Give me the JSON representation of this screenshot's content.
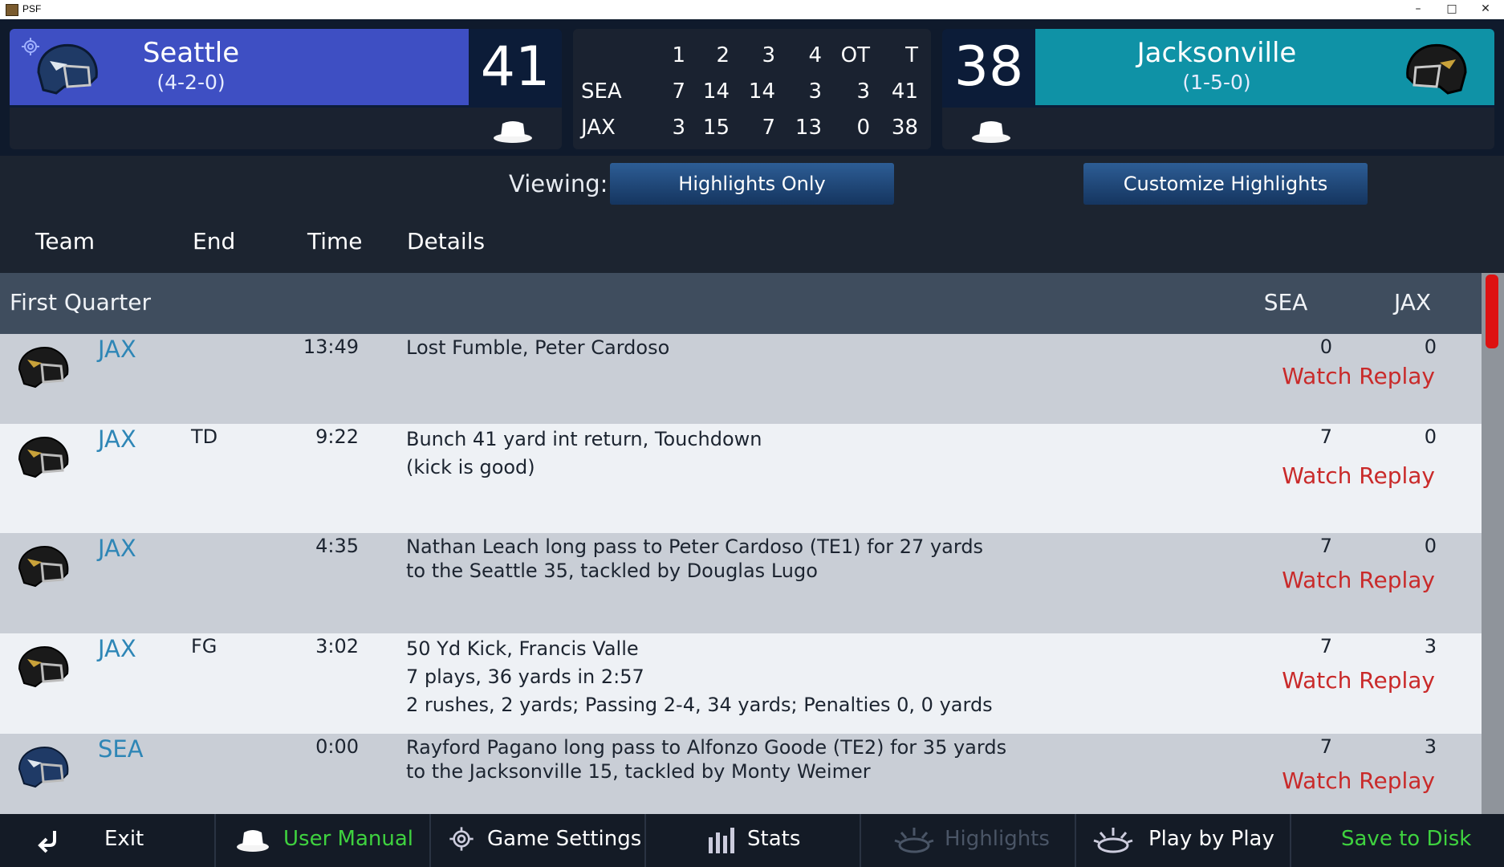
{
  "window": {
    "title": "PSF",
    "minimize": "–",
    "maximize": "□",
    "close": "✕"
  },
  "home": {
    "name": "Seattle",
    "record": "(4-2-0)",
    "score": "41",
    "color": "#3e4fc3"
  },
  "away": {
    "name": "Jacksonville",
    "record": "(1-5-0)",
    "score": "38",
    "color": "#0f92a6"
  },
  "linescore": {
    "headers": [
      "1",
      "2",
      "3",
      "4",
      "OT",
      "T"
    ],
    "rows": [
      {
        "team": "SEA",
        "values": [
          "7",
          "14",
          "14",
          "3",
          "3",
          "41"
        ]
      },
      {
        "team": "JAX",
        "values": [
          "3",
          "15",
          "7",
          "13",
          "0",
          "38"
        ]
      }
    ]
  },
  "viewing": {
    "label": "Viewing:",
    "mode": "Highlights Only",
    "customize": "Customize Highlights"
  },
  "columns": {
    "team": "Team",
    "end": "End",
    "time": "Time",
    "details": "Details"
  },
  "quarter": {
    "title": "First Quarter",
    "col1": "SEA",
    "col2": "JAX"
  },
  "plays": [
    {
      "team": "JAX",
      "end": "",
      "time": "13:49",
      "details": [
        "Lost Fumble, Peter Cardoso"
      ],
      "sea": "0",
      "jax": "0",
      "replay": "Watch Replay",
      "helmet": "jaguar-helmet"
    },
    {
      "team": "JAX",
      "end": "TD",
      "time": "9:22",
      "details": [
        "Bunch 41 yard int return, Touchdown",
        "(kick is good)"
      ],
      "sea": "7",
      "jax": "0",
      "replay": "Watch Replay",
      "helmet": "jaguar-helmet"
    },
    {
      "team": "JAX",
      "end": "",
      "time": "4:35",
      "details": [
        "Nathan Leach long pass to Peter Cardoso (TE1) for 27 yards",
        "to the Seattle 35, tackled by Douglas Lugo"
      ],
      "sea": "7",
      "jax": "0",
      "replay": "Watch Replay",
      "helmet": "jaguar-helmet"
    },
    {
      "team": "JAX",
      "end": "FG",
      "time": "3:02",
      "details": [
        "50 Yd Kick, Francis Valle",
        "7 plays, 36 yards in 2:57",
        "2 rushes, 2 yards;  Passing 2-4, 34 yards;  Penalties 0, 0 yards"
      ],
      "sea": "7",
      "jax": "3",
      "replay": "Watch Replay",
      "helmet": "jaguar-helmet"
    },
    {
      "team": "SEA",
      "end": "",
      "time": "0:00",
      "details": [
        "Rayford Pagano long pass to Alfonzo Goode (TE2) for 35 yards",
        "to the Jacksonville 15, tackled by Monty Weimer"
      ],
      "sea": "7",
      "jax": "3",
      "replay": "Watch Replay",
      "helmet": "seahawk-helmet"
    }
  ],
  "nav": {
    "exit": "Exit",
    "manual": "User Manual",
    "settings": "Game Settings",
    "stats": "Stats",
    "highlights": "Highlights",
    "pbp": "Play by Play",
    "save": "Save to Disk"
  },
  "colors": {
    "replay": "#c92a2a",
    "team_link": "#2e86b6",
    "green_text": "#3fd23f",
    "scroll_thumb": "#dd1111"
  }
}
